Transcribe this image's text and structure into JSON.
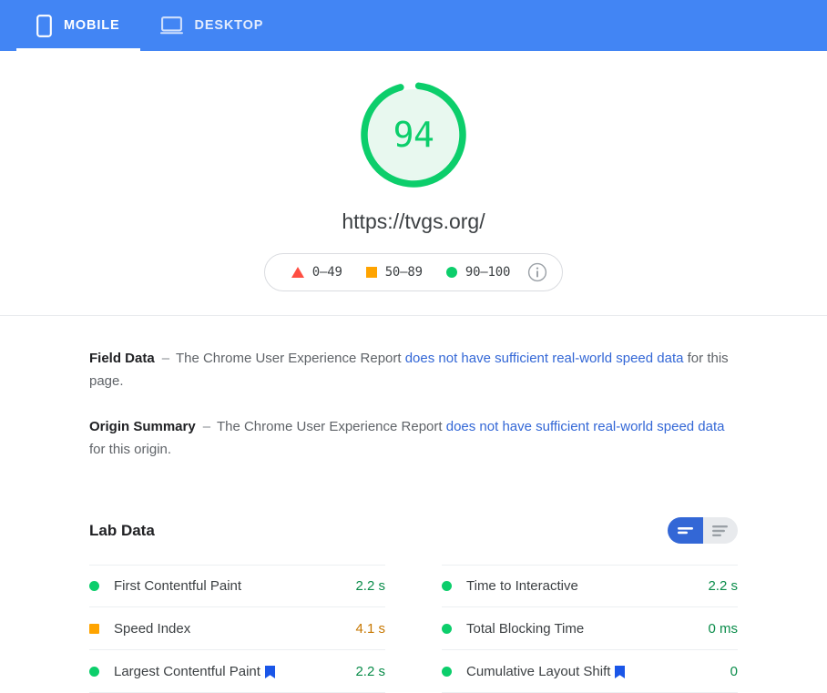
{
  "tabs": [
    {
      "label": "MOBILE",
      "icon": "mobile-phone-icon",
      "active": true
    },
    {
      "label": "DESKTOP",
      "icon": "desktop-monitor-icon",
      "active": false
    }
  ],
  "score": {
    "value": "94",
    "max": 100,
    "color": "#0cce6b",
    "track_color": "#e8f8ef",
    "url": "https://tvgs.org/"
  },
  "legend": {
    "items": [
      {
        "icon": "red-triangle-icon",
        "range": "0–49",
        "color": "#ff4e42"
      },
      {
        "icon": "orange-square-icon",
        "range": "50–89",
        "color": "#ffa400"
      },
      {
        "icon": "green-circle-icon",
        "range": "90–100",
        "color": "#0cce6b"
      }
    ],
    "info_icon": "info-circle-icon"
  },
  "field_data": {
    "title": "Field Data",
    "dash": "–",
    "text_before": "The Chrome User Experience Report",
    "link": "does not have sufficient real-world speed data",
    "text_after": "for this page."
  },
  "origin_summary": {
    "title": "Origin Summary",
    "dash": "–",
    "text_before": "The Chrome User Experience Report",
    "link": "does not have sufficient real-world speed data",
    "text_after": "for this origin."
  },
  "lab_data": {
    "title": "Lab Data",
    "view_toggle": {
      "compact": {
        "icon": "list-compact-icon",
        "active": true
      },
      "expanded": {
        "icon": "list-expanded-icon",
        "active": false
      }
    },
    "left_column": [
      {
        "name": "First Contentful Paint",
        "value": "2.2 s",
        "status": "green",
        "status_color": "#0cce6b",
        "value_color": "#0a8c4a",
        "flag": false
      },
      {
        "name": "Speed Index",
        "value": "4.1 s",
        "status": "orange",
        "status_color": "#ffa400",
        "value_color": "#c77700",
        "flag": false
      },
      {
        "name": "Largest Contentful Paint",
        "value": "2.2 s",
        "status": "green",
        "status_color": "#0cce6b",
        "value_color": "#0a8c4a",
        "flag": true
      }
    ],
    "right_column": [
      {
        "name": "Time to Interactive",
        "value": "2.2 s",
        "status": "green",
        "status_color": "#0cce6b",
        "value_color": "#0a8c4a",
        "flag": false
      },
      {
        "name": "Total Blocking Time",
        "value": "0 ms",
        "status": "green",
        "status_color": "#0cce6b",
        "value_color": "#0a8c4a",
        "flag": false
      },
      {
        "name": "Cumulative Layout Shift",
        "value": "0",
        "status": "green",
        "status_color": "#0cce6b",
        "value_color": "#0a8c4a",
        "flag": true
      }
    ],
    "flag_icon": "blue-bookmark-flag-icon",
    "flag_color": "#1a56e8"
  },
  "theme": {
    "header_blue": "#4285f4",
    "link_blue": "#3367d6",
    "toggle_active": "#3367d6",
    "toggle_inactive": "#e8eaed"
  }
}
